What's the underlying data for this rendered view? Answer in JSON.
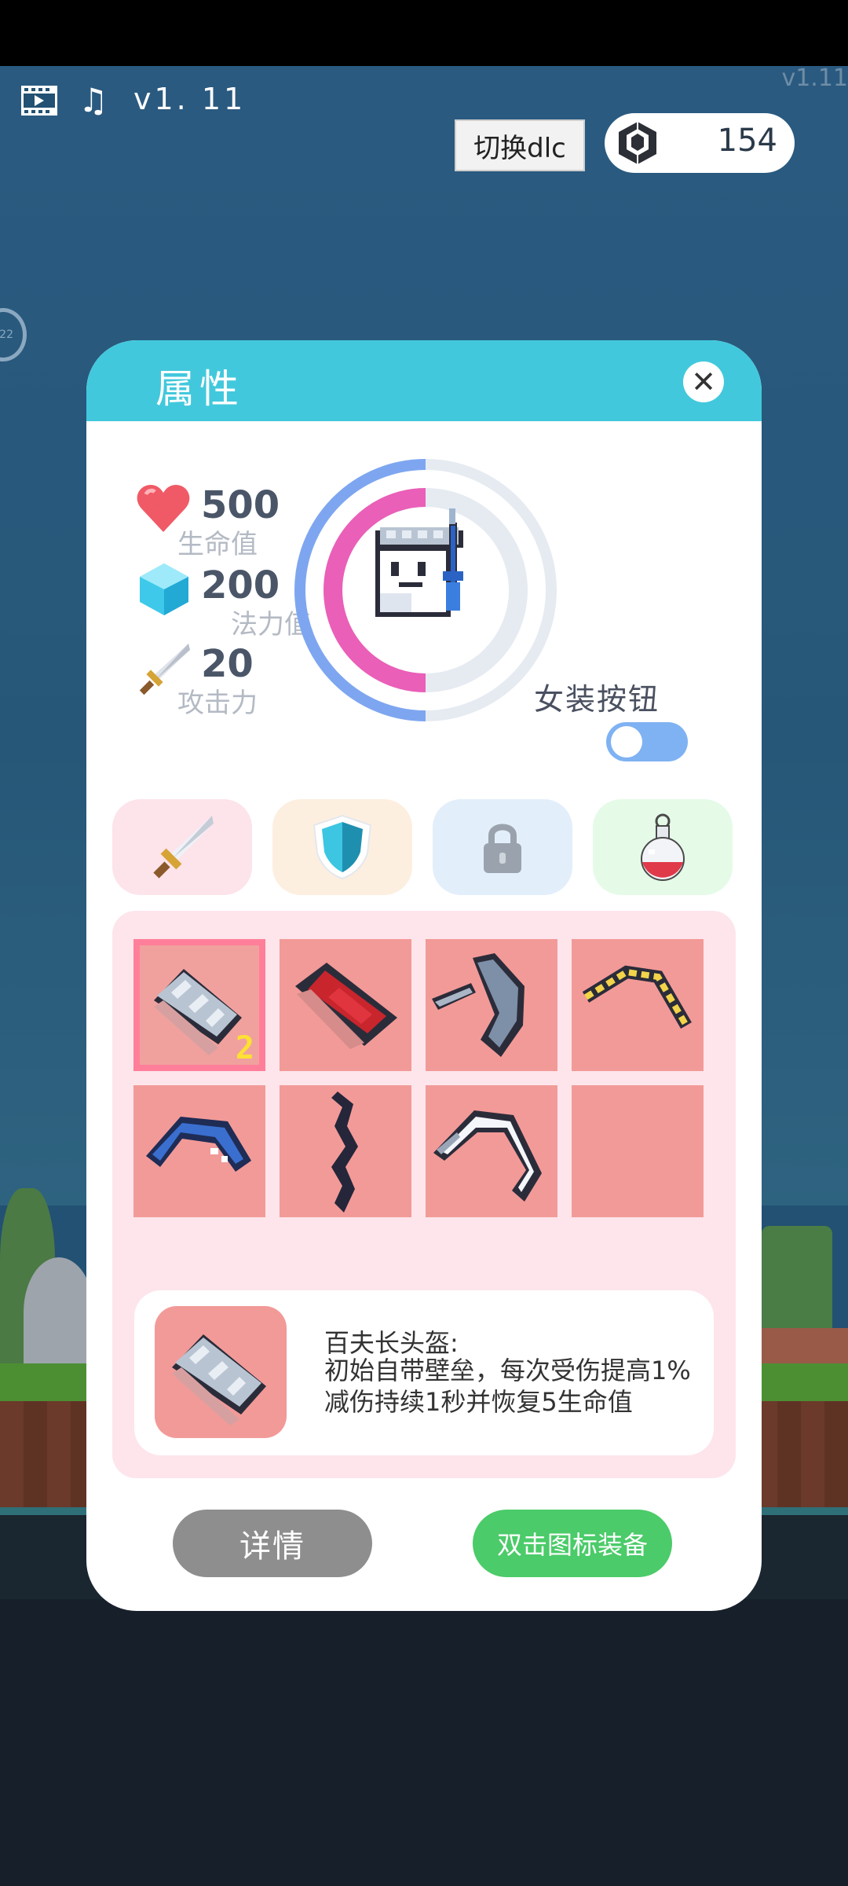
{
  "hud": {
    "version": "v1. 11",
    "corner_version": "v1.11",
    "dlc_button": "切换dlc",
    "gem_count": "154",
    "film_icon": "film-icon",
    "music_icon": "music-note-icon",
    "gem_icon": "gem-icon"
  },
  "panel": {
    "title": "属性",
    "close_glyph": "✕"
  },
  "stats": [
    {
      "icon": "heart-icon",
      "value": "500",
      "label": "生命值",
      "color": "#f05a66"
    },
    {
      "icon": "crystal-icon",
      "value": "200",
      "label": "法力值",
      "color": "#3ec9ea"
    },
    {
      "icon": "sword-icon",
      "value": "20",
      "label": "攻击力",
      "color": "#d9dde4"
    }
  ],
  "rings": {
    "outer_fraction": 0.5,
    "inner_fraction": 0.5,
    "outer_color": "#7ea6f0",
    "inner_color": "#ea5fb8"
  },
  "toggle": {
    "label": "女装按钮",
    "on": false
  },
  "tabs": [
    {
      "name": "weapon-tab",
      "icon": "sword-icon",
      "bg": "#fde3ea"
    },
    {
      "name": "armor-tab",
      "icon": "shield-icon",
      "bg": "#fdefe0"
    },
    {
      "name": "locked-tab",
      "icon": "lock-icon",
      "bg": "#e3eefb"
    },
    {
      "name": "potion-tab",
      "icon": "potion-icon",
      "bg": "#e5fbe8"
    }
  ],
  "inventory": {
    "slots": [
      {
        "icon": "helmet-icon",
        "selected": true,
        "level": "2"
      },
      {
        "icon": "red-armor-icon"
      },
      {
        "icon": "axe-icon"
      },
      {
        "icon": "gold-boomerang-icon"
      },
      {
        "icon": "blue-boomerang-icon"
      },
      {
        "icon": "dark-staff-icon"
      },
      {
        "icon": "white-boomerang-icon"
      },
      {
        "icon": "empty-slot"
      }
    ]
  },
  "detail": {
    "name": "百夫长头盔:",
    "description": "初始自带壁垒，每次受伤提高1%减伤持续1秒并恢复5生命值"
  },
  "buttons": {
    "detail": "详情",
    "equip": "双击图标装备"
  }
}
